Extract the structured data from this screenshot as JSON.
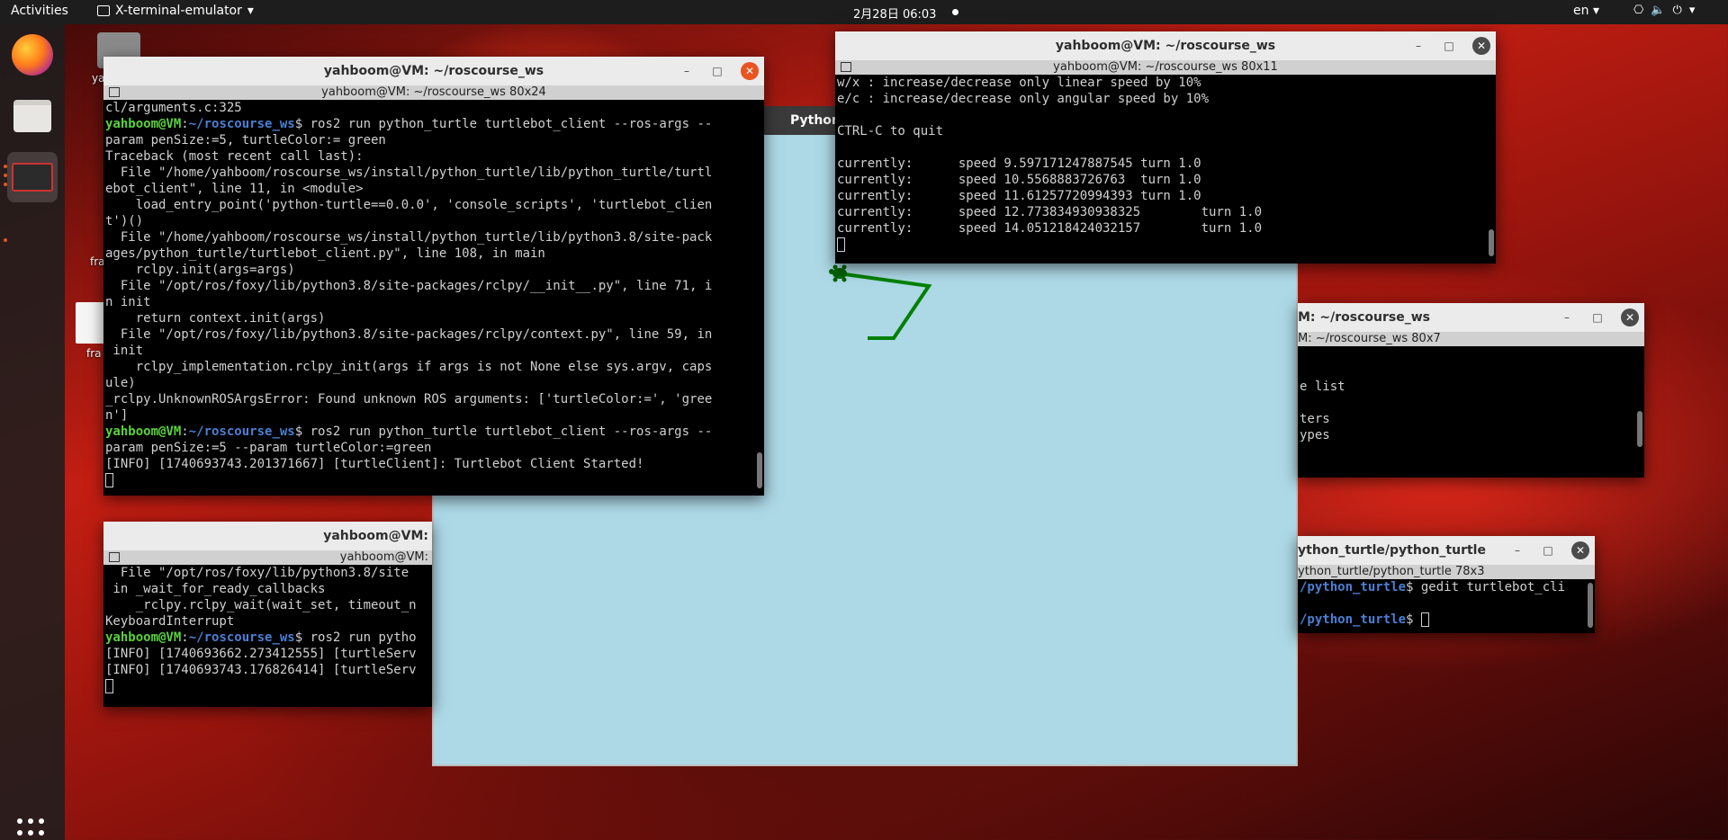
{
  "topbar": {
    "activities": "Activities",
    "app_name": "X-terminal-emulator",
    "clock": "2月28日  06:03",
    "lang": "en",
    "sys_icons": [
      "network-icon",
      "volume-icon",
      "power-icon"
    ]
  },
  "dock": {
    "items": [
      "firefox",
      "files",
      "terminal"
    ],
    "apps_grid": "show-applications"
  },
  "desktop": {
    "icon1_label": "ya",
    "icon2_label": "fra",
    "icon3_label": "fra"
  },
  "turtle": {
    "title": "Python",
    "bg": "#add8e6",
    "pen_color": "green",
    "pen_size": 5
  },
  "win_main": {
    "title": "yahboom@VM: ~/roscourse_ws",
    "subtitle": "yahboom@VM: ~/roscourse_ws 80x24",
    "lines": [
      {
        "t": "cl/arguments.c:325"
      },
      {
        "p": "yahboom@VM",
        "d": "~/roscourse_ws",
        "c": "$ ros2 run python_turtle turtlebot_client --ros-args --"
      },
      {
        "t": "param penSize:=5, turtleColor:= green"
      },
      {
        "t": "Traceback (most recent call last):"
      },
      {
        "t": "  File \"/home/yahboom/roscourse_ws/install/python_turtle/lib/python_turtle/turtl"
      },
      {
        "t": "ebot_client\", line 11, in <module>"
      },
      {
        "t": "    load_entry_point('python-turtle==0.0.0', 'console_scripts', 'turtlebot_clien"
      },
      {
        "t": "t')()"
      },
      {
        "t": "  File \"/home/yahboom/roscourse_ws/install/python_turtle/lib/python3.8/site-pack"
      },
      {
        "t": "ages/python_turtle/turtlebot_client.py\", line 108, in main"
      },
      {
        "t": "    rclpy.init(args=args)"
      },
      {
        "t": "  File \"/opt/ros/foxy/lib/python3.8/site-packages/rclpy/__init__.py\", line 71, i"
      },
      {
        "t": "n init"
      },
      {
        "t": "    return context.init(args)"
      },
      {
        "t": "  File \"/opt/ros/foxy/lib/python3.8/site-packages/rclpy/context.py\", line 59, in"
      },
      {
        "t": " init"
      },
      {
        "t": "    rclpy_implementation.rclpy_init(args if args is not None else sys.argv, caps"
      },
      {
        "t": "ule)"
      },
      {
        "t": "_rclpy.UnknownROSArgsError: Found unknown ROS arguments: ['turtleColor:=', 'gree"
      },
      {
        "t": "n']"
      },
      {
        "p": "yahboom@VM",
        "d": "~/roscourse_ws",
        "c": "$ ros2 run python_turtle turtlebot_client --ros-args --"
      },
      {
        "t": "param penSize:=5 --param turtleColor:=green"
      },
      {
        "t": "[INFO] [1740693743.201371667] [turtleClient]: Turtlebot Client Started!"
      }
    ]
  },
  "win_keys": {
    "title": "yahboom@VM: ~/roscourse_ws",
    "subtitle": "yahboom@VM: ~/roscourse_ws 80x11",
    "lines": [
      "w/x : increase/decrease only linear speed by 10%",
      "e/c : increase/decrease only angular speed by 10%",
      "",
      "CTRL-C to quit",
      "",
      "currently:      speed 9.597171247887545 turn 1.0",
      "currently:      speed 10.5568883726763  turn 1.0",
      "currently:      speed 11.61257720994393 turn 1.0",
      "currently:      speed 12.773834930938325        turn 1.0",
      "currently:      speed 14.051218424032157        turn 1.0"
    ]
  },
  "win_server": {
    "title": "yahboom@VM:",
    "subtitle": "yahboom@VM: ",
    "lines": [
      {
        "t": "  File \"/opt/ros/foxy/lib/python3.8/site"
      },
      {
        "t": " in _wait_for_ready_callbacks"
      },
      {
        "t": "    _rclpy.rclpy_wait(wait_set, timeout_n"
      },
      {
        "t": "KeyboardInterrupt"
      },
      {
        "p": "yahboom@VM",
        "d": "~/roscourse_ws",
        "c": "$ ros2 run pytho"
      },
      {
        "t": "[INFO] [1740693662.273412555] [turtleServ"
      },
      {
        "t": "[INFO] [1740693743.176826414] [turtleServ"
      }
    ]
  },
  "win_params": {
    "title": "M: ~/roscourse_ws",
    "subtitle": "M: ~/roscourse_ws 80x7",
    "lines": [
      "",
      "",
      "e list",
      "",
      "ters",
      "ypes"
    ]
  },
  "win_gedit": {
    "title": "ython_turtle/python_turtle",
    "subtitle": "ython_turtle/python_turtle 78x3",
    "lines": [
      {
        "d": "/python_turtle",
        "c": "$ gedit turtlebot_cli"
      },
      {
        "d": "",
        "c": ""
      },
      {
        "d": "/python_turtle",
        "c": "$ "
      }
    ]
  }
}
